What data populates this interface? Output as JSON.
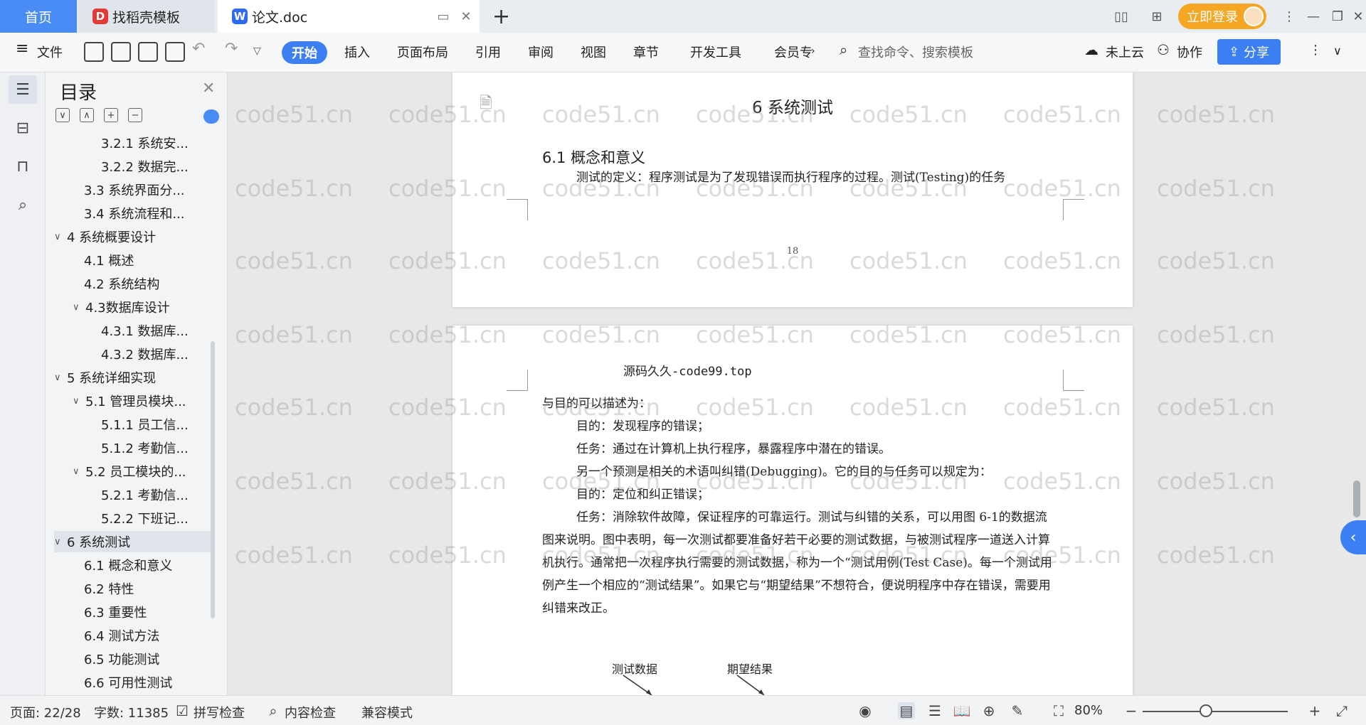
{
  "tabs": {
    "home": "首页",
    "templates": "找稻壳模板",
    "document": "论文.doc",
    "login": "立即登录"
  },
  "ribbon": {
    "file": "文件",
    "start": "开始",
    "insert": "插入",
    "layout": "页面布局",
    "reference": "引用",
    "review": "审阅",
    "view": "视图",
    "chapter": "章节",
    "devtools": "开发工具",
    "member": "会员专",
    "search_placeholder": "查找命令、搜索模板",
    "cloud": "未上云",
    "collab": "协作",
    "share": "分享"
  },
  "toc": {
    "title": "目录",
    "items": [
      {
        "label": "3.2.1 系统安...",
        "level": 3,
        "chevron": ""
      },
      {
        "label": "3.2.2 数据完...",
        "level": 3,
        "chevron": ""
      },
      {
        "label": "3.3 系统界面分...",
        "level": 2,
        "chevron": ""
      },
      {
        "label": "3.4 系统流程和...",
        "level": 2,
        "chevron": ""
      },
      {
        "label": "4 系统概要设计",
        "level": 1,
        "chevron": "∨"
      },
      {
        "label": "4.1 概述",
        "level": 2,
        "chevron": ""
      },
      {
        "label": "4.2 系统结构",
        "level": 2,
        "chevron": ""
      },
      {
        "label": "4.3数据库设计",
        "level": 2,
        "chevron": "∨"
      },
      {
        "label": "4.3.1 数据库...",
        "level": 3,
        "chevron": ""
      },
      {
        "label": "4.3.2 数据库...",
        "level": 3,
        "chevron": ""
      },
      {
        "label": "5 系统详细实现",
        "level": 1,
        "chevron": "∨"
      },
      {
        "label": "5.1 管理员模块...",
        "level": 2,
        "chevron": "∨"
      },
      {
        "label": "5.1.1 员工信...",
        "level": 3,
        "chevron": ""
      },
      {
        "label": "5.1.2 考勤信...",
        "level": 3,
        "chevron": ""
      },
      {
        "label": "5.2 员工模块的...",
        "level": 2,
        "chevron": "∨"
      },
      {
        "label": "5.2.1 考勤信...",
        "level": 3,
        "chevron": ""
      },
      {
        "label": "5.2.2 下班记...",
        "level": 3,
        "chevron": ""
      },
      {
        "label": "6 系统测试",
        "level": 1,
        "chevron": "∨",
        "selected": true
      },
      {
        "label": "6.1 概念和意义",
        "level": 2,
        "chevron": ""
      },
      {
        "label": "6.2 特性",
        "level": 2,
        "chevron": ""
      },
      {
        "label": "6.3 重要性",
        "level": 2,
        "chevron": ""
      },
      {
        "label": "6.4 测试方法",
        "level": 2,
        "chevron": ""
      },
      {
        "label": "6.5 功能测试",
        "level": 2,
        "chevron": ""
      },
      {
        "label": "6.6 可用性测试",
        "level": 2,
        "chevron": ""
      }
    ]
  },
  "page1": {
    "heading1": "6 系统测试",
    "heading2": "6.1 概念和意义",
    "para1": "测试的定义：程序测试是为了发现错误而执行程序的过程。测试(Testing)的任务",
    "page_number": "18"
  },
  "page2": {
    "header": "源码久久-code99.top",
    "lines": [
      {
        "text": "与目的可以描述为：",
        "indent": false
      },
      {
        "text": "目的：发现程序的错误；",
        "indent": true
      },
      {
        "text": "任务：通过在计算机上执行程序，暴露程序中潜在的错误。",
        "indent": true
      },
      {
        "text": "另一个预测是相关的术语叫纠错(Debugging)。它的目的与任务可以规定为：",
        "indent": true
      },
      {
        "text": "目的：定位和纠正错误；",
        "indent": true
      },
      {
        "text": "任务：消除软件故障，保证程序的可靠运行。测试与纠错的关系，可以用图 6-1的数据流图来说明。图中表明，每一次测试都要准备好若干必要的测试数据，与被测试程序一道送入计算机执行。通常把一次程序执行需要的测试数据，称为一个“测试用例(Test Case)。每一个测试用例产生一个相应的“测试结果”。如果它与“期望结果”不想符合，便说明程序中存在错误，需要用纠错来改正。",
        "indent": true
      }
    ],
    "diagram_label_1": "测试数据",
    "diagram_label_2": "期望结果"
  },
  "watermark": "code51.cn",
  "status": {
    "page": "页面: 22/28",
    "words": "字数: 11385",
    "spell": "拼写检查",
    "content": "内容检查",
    "compat": "兼容模式",
    "zoom": "80%"
  }
}
